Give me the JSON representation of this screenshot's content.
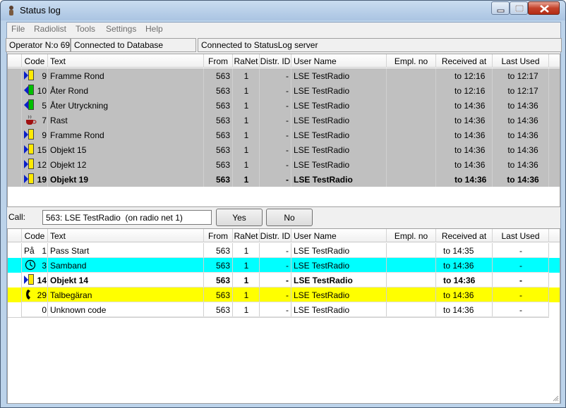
{
  "window": {
    "title": "Status log"
  },
  "menu": [
    "File",
    "Radiolist",
    "Tools",
    "Settings",
    "Help"
  ],
  "status": {
    "operator": "Operator N:o 69",
    "db": "Connected to Database",
    "server": "Connected to StatusLog server"
  },
  "columns": [
    "Code",
    "Text",
    "From",
    "RaNet",
    "Distr. ID",
    "User Name",
    "Empl. no",
    "Received at",
    "Last Used"
  ],
  "top_rows": [
    {
      "icon": "arrow-right-flag-icon",
      "code": "9",
      "text": "Framme Rond",
      "from": "563",
      "ranet": "1",
      "distr": "-",
      "user": "LSE TestRadio",
      "empl": "",
      "received": "to 12:16",
      "last": "to 12:17",
      "bold": false
    },
    {
      "icon": "arrow-left-flag-icon",
      "code": "10",
      "text": "Åter Rond",
      "from": "563",
      "ranet": "1",
      "distr": "-",
      "user": "LSE TestRadio",
      "empl": "",
      "received": "to 12:16",
      "last": "to 12:17",
      "bold": false
    },
    {
      "icon": "arrow-left-flag-icon",
      "code": "5",
      "text": "Åter Utryckning",
      "from": "563",
      "ranet": "1",
      "distr": "-",
      "user": "LSE TestRadio",
      "empl": "",
      "received": "to 14:36",
      "last": "to 14:36",
      "bold": false
    },
    {
      "icon": "coffee-cup-icon",
      "code": "7",
      "text": "Rast",
      "from": "563",
      "ranet": "1",
      "distr": "-",
      "user": "LSE TestRadio",
      "empl": "",
      "received": "to 14:36",
      "last": "to 14:36",
      "bold": false
    },
    {
      "icon": "arrow-right-flag-icon",
      "code": "9",
      "text": "Framme Rond",
      "from": "563",
      "ranet": "1",
      "distr": "-",
      "user": "LSE TestRadio",
      "empl": "",
      "received": "to 14:36",
      "last": "to 14:36",
      "bold": false
    },
    {
      "icon": "arrow-right-flag-icon",
      "code": "15",
      "text": "Objekt 15",
      "from": "563",
      "ranet": "1",
      "distr": "-",
      "user": "LSE TestRadio",
      "empl": "",
      "received": "to 14:36",
      "last": "to 14:36",
      "bold": false
    },
    {
      "icon": "arrow-right-flag-icon",
      "code": "12",
      "text": "Objekt 12",
      "from": "563",
      "ranet": "1",
      "distr": "-",
      "user": "LSE TestRadio",
      "empl": "",
      "received": "to 14:36",
      "last": "to 14:36",
      "bold": false
    },
    {
      "icon": "arrow-right-flag-icon",
      "code": "19",
      "text": "Objekt 19",
      "from": "563",
      "ranet": "1",
      "distr": "-",
      "user": "LSE TestRadio",
      "empl": "",
      "received": "to 14:36",
      "last": "to 14:36",
      "bold": true
    }
  ],
  "call": {
    "label": "Call:",
    "value": "563: LSE TestRadio  (on radio net 1)",
    "yes": "Yes",
    "no": "No"
  },
  "bottom_rows": [
    {
      "icon": "text-pa-icon",
      "icon_text": "På",
      "code": "1",
      "text": "Pass Start",
      "from": "563",
      "ranet": "1",
      "distr": "-",
      "user": "LSE TestRadio",
      "empl": "",
      "received": "to 14:35",
      "last": "-",
      "bold": false,
      "bg": "#ffffff"
    },
    {
      "icon": "clock-icon",
      "code": "3",
      "text": "Samband",
      "from": "563",
      "ranet": "1",
      "distr": "-",
      "user": "LSE TestRadio",
      "empl": "",
      "received": "to 14:36",
      "last": "-",
      "bold": false,
      "bg": "#00ffff"
    },
    {
      "icon": "arrow-right-flag-icon",
      "code": "14",
      "text": "Objekt 14",
      "from": "563",
      "ranet": "1",
      "distr": "-",
      "user": "LSE TestRadio",
      "empl": "",
      "received": "to 14:36",
      "last": "-",
      "bold": true,
      "bg": "#ffffff"
    },
    {
      "icon": "phone-icon",
      "code": "29",
      "text": "Talbegäran",
      "from": "563",
      "ranet": "1",
      "distr": "-",
      "user": "LSE TestRadio",
      "empl": "",
      "received": "to 14:36",
      "last": "-",
      "bold": false,
      "bg": "#ffff00"
    },
    {
      "icon": "",
      "code": "0",
      "text": "Unknown code",
      "from": "563",
      "ranet": "1",
      "distr": "-",
      "user": "LSE TestRadio",
      "empl": "",
      "received": "to 14:36",
      "last": "-",
      "bold": false,
      "bg": "#ffffff"
    }
  ],
  "colors": {
    "top_bg": "#c0c0c0",
    "cyan": "#00ffff",
    "yellow": "#ffff00",
    "titlebar": "#bcd3ea"
  }
}
